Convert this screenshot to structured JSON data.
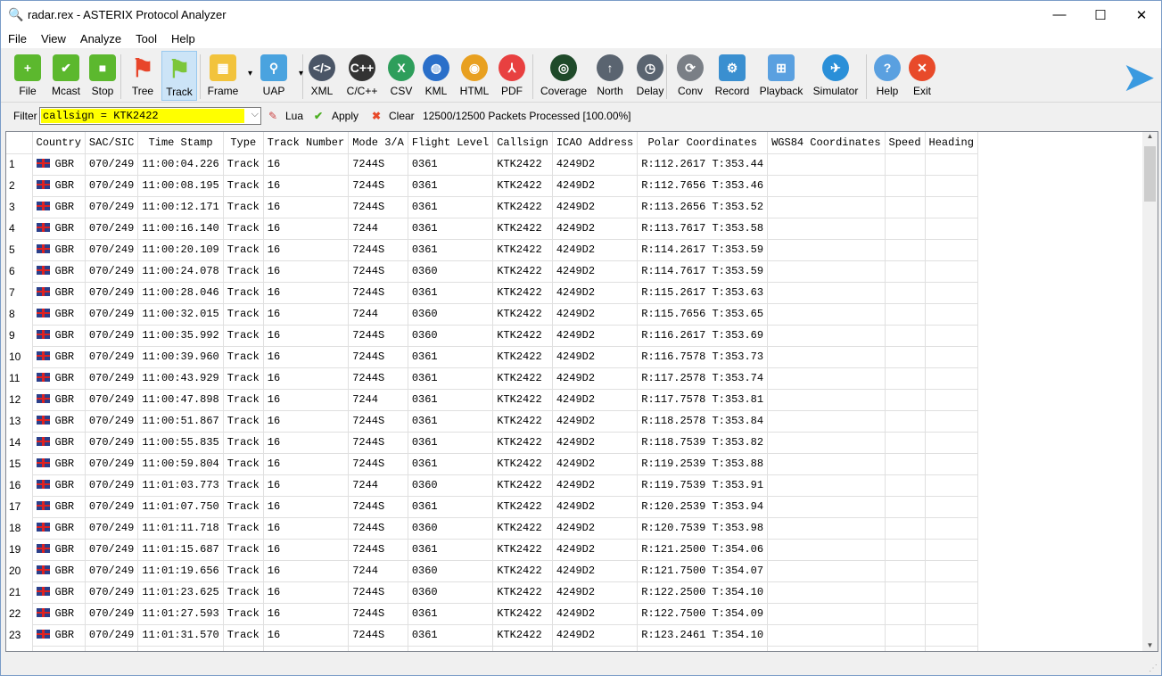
{
  "window": {
    "title": "radar.rex - ASTERIX Protocol Analyzer",
    "minimize": "—",
    "maximize": "☐",
    "close": "✕"
  },
  "menu": [
    "File",
    "View",
    "Analyze",
    "Tool",
    "Help"
  ],
  "toolbar": [
    {
      "label": "File",
      "icon": "plus-icon",
      "color": "#5cb82e",
      "glyph": "+"
    },
    {
      "label": "Mcast",
      "icon": "check-icon",
      "color": "#5cb82e",
      "glyph": "✔"
    },
    {
      "label": "Stop",
      "icon": "stop-icon",
      "color": "#5cb82e",
      "glyph": "■"
    },
    {
      "label": "Tree",
      "icon": "red-flag-icon",
      "color": "#e8452a",
      "glyph": "⚑"
    },
    {
      "label": "Track",
      "icon": "green-flag-icon",
      "color": "#7cc63a",
      "glyph": "⚑"
    },
    {
      "label": "Frame",
      "icon": "calendar-icon",
      "color": "#f2c33c",
      "glyph": "▦"
    },
    {
      "label": "UAP",
      "icon": "key-icon",
      "color": "#4aa3df",
      "glyph": "⚲"
    },
    {
      "label": "XML",
      "icon": "code-icon",
      "color": "#4a5566",
      "glyph": "</>"
    },
    {
      "label": "C/C++",
      "icon": "cpp-icon",
      "color": "#333333",
      "glyph": "C++"
    },
    {
      "label": "CSV",
      "icon": "excel-icon",
      "color": "#2e9e5b",
      "glyph": "X"
    },
    {
      "label": "KML",
      "icon": "globe-icon",
      "color": "#2a6fc9",
      "glyph": "◍"
    },
    {
      "label": "HTML",
      "icon": "chrome-icon",
      "color": "#e8a020",
      "glyph": "◉"
    },
    {
      "label": "PDF",
      "icon": "pdf-icon",
      "color": "#e84040",
      "glyph": "⅄"
    },
    {
      "label": "Coverage",
      "icon": "radar-icon",
      "color": "#1f4a2a",
      "glyph": "◎"
    },
    {
      "label": "North",
      "icon": "arrow-up-icon",
      "color": "#5a6470",
      "glyph": "↑"
    },
    {
      "label": "Delay",
      "icon": "clock-icon",
      "color": "#5a6470",
      "glyph": "◷"
    },
    {
      "label": "Conv",
      "icon": "convert-icon",
      "color": "#7a7f86",
      "glyph": "⟳"
    },
    {
      "label": "Record",
      "icon": "gear-icon",
      "color": "#3a8fd0",
      "glyph": "⚙"
    },
    {
      "label": "Playback",
      "icon": "network-icon",
      "color": "#5aa0e0",
      "glyph": "⊞"
    },
    {
      "label": "Simulator",
      "icon": "plane-icon",
      "color": "#2a8fd8",
      "glyph": "✈"
    },
    {
      "label": "Help",
      "icon": "help-icon",
      "color": "#5aa0e0",
      "glyph": "?"
    },
    {
      "label": "Exit",
      "icon": "close-icon",
      "color": "#e84a2a",
      "glyph": "✕"
    }
  ],
  "filter": {
    "label": "Filter",
    "value": "callsign = KTK2422",
    "lua": "Lua",
    "apply": "Apply",
    "clear": "Clear",
    "status": "12500/12500 Packets Processed [100.00%]"
  },
  "table": {
    "columns": [
      "",
      "Country",
      "SAC/SIC",
      "Time Stamp",
      "Type",
      "Track Number",
      "Mode 3/A",
      "Flight Level",
      "Callsign",
      "ICAO Address",
      "Polar Coordinates",
      "WGS84 Coordinates",
      "Speed",
      "Heading"
    ],
    "rows": [
      [
        "1",
        "GBR",
        "070/249",
        "11:00:04.226",
        "Track",
        "16",
        "7244S",
        "0361",
        "KTK2422",
        "4249D2",
        "R:112.2617 T:353.44",
        "",
        "",
        ""
      ],
      [
        "2",
        "GBR",
        "070/249",
        "11:00:08.195",
        "Track",
        "16",
        "7244S",
        "0361",
        "KTK2422",
        "4249D2",
        "R:112.7656 T:353.46",
        "",
        "",
        ""
      ],
      [
        "3",
        "GBR",
        "070/249",
        "11:00:12.171",
        "Track",
        "16",
        "7244S",
        "0361",
        "KTK2422",
        "4249D2",
        "R:113.2656 T:353.52",
        "",
        "",
        ""
      ],
      [
        "4",
        "GBR",
        "070/249",
        "11:00:16.140",
        "Track",
        "16",
        "7244",
        "0361",
        "KTK2422",
        "4249D2",
        "R:113.7617 T:353.58",
        "",
        "",
        ""
      ],
      [
        "5",
        "GBR",
        "070/249",
        "11:00:20.109",
        "Track",
        "16",
        "7244S",
        "0361",
        "KTK2422",
        "4249D2",
        "R:114.2617 T:353.59",
        "",
        "",
        ""
      ],
      [
        "6",
        "GBR",
        "070/249",
        "11:00:24.078",
        "Track",
        "16",
        "7244S",
        "0360",
        "KTK2422",
        "4249D2",
        "R:114.7617 T:353.59",
        "",
        "",
        ""
      ],
      [
        "7",
        "GBR",
        "070/249",
        "11:00:28.046",
        "Track",
        "16",
        "7244S",
        "0361",
        "KTK2422",
        "4249D2",
        "R:115.2617 T:353.63",
        "",
        "",
        ""
      ],
      [
        "8",
        "GBR",
        "070/249",
        "11:00:32.015",
        "Track",
        "16",
        "7244",
        "0360",
        "KTK2422",
        "4249D2",
        "R:115.7656 T:353.65",
        "",
        "",
        ""
      ],
      [
        "9",
        "GBR",
        "070/249",
        "11:00:35.992",
        "Track",
        "16",
        "7244S",
        "0360",
        "KTK2422",
        "4249D2",
        "R:116.2617 T:353.69",
        "",
        "",
        ""
      ],
      [
        "10",
        "GBR",
        "070/249",
        "11:00:39.960",
        "Track",
        "16",
        "7244S",
        "0361",
        "KTK2422",
        "4249D2",
        "R:116.7578 T:353.73",
        "",
        "",
        ""
      ],
      [
        "11",
        "GBR",
        "070/249",
        "11:00:43.929",
        "Track",
        "16",
        "7244S",
        "0361",
        "KTK2422",
        "4249D2",
        "R:117.2578 T:353.74",
        "",
        "",
        ""
      ],
      [
        "12",
        "GBR",
        "070/249",
        "11:00:47.898",
        "Track",
        "16",
        "7244",
        "0361",
        "KTK2422",
        "4249D2",
        "R:117.7578 T:353.81",
        "",
        "",
        ""
      ],
      [
        "13",
        "GBR",
        "070/249",
        "11:00:51.867",
        "Track",
        "16",
        "7244S",
        "0361",
        "KTK2422",
        "4249D2",
        "R:118.2578 T:353.84",
        "",
        "",
        ""
      ],
      [
        "14",
        "GBR",
        "070/249",
        "11:00:55.835",
        "Track",
        "16",
        "7244S",
        "0361",
        "KTK2422",
        "4249D2",
        "R:118.7539 T:353.82",
        "",
        "",
        ""
      ],
      [
        "15",
        "GBR",
        "070/249",
        "11:00:59.804",
        "Track",
        "16",
        "7244S",
        "0361",
        "KTK2422",
        "4249D2",
        "R:119.2539 T:353.88",
        "",
        "",
        ""
      ],
      [
        "16",
        "GBR",
        "070/249",
        "11:01:03.773",
        "Track",
        "16",
        "7244",
        "0360",
        "KTK2422",
        "4249D2",
        "R:119.7539 T:353.91",
        "",
        "",
        ""
      ],
      [
        "17",
        "GBR",
        "070/249",
        "11:01:07.750",
        "Track",
        "16",
        "7244S",
        "0361",
        "KTK2422",
        "4249D2",
        "R:120.2539 T:353.94",
        "",
        "",
        ""
      ],
      [
        "18",
        "GBR",
        "070/249",
        "11:01:11.718",
        "Track",
        "16",
        "7244S",
        "0360",
        "KTK2422",
        "4249D2",
        "R:120.7539 T:353.98",
        "",
        "",
        ""
      ],
      [
        "19",
        "GBR",
        "070/249",
        "11:01:15.687",
        "Track",
        "16",
        "7244S",
        "0361",
        "KTK2422",
        "4249D2",
        "R:121.2500 T:354.06",
        "",
        "",
        ""
      ],
      [
        "20",
        "GBR",
        "070/249",
        "11:01:19.656",
        "Track",
        "16",
        "7244",
        "0360",
        "KTK2422",
        "4249D2",
        "R:121.7500 T:354.07",
        "",
        "",
        ""
      ],
      [
        "21",
        "GBR",
        "070/249",
        "11:01:23.625",
        "Track",
        "16",
        "7244S",
        "0360",
        "KTK2422",
        "4249D2",
        "R:122.2500 T:354.10",
        "",
        "",
        ""
      ],
      [
        "22",
        "GBR",
        "070/249",
        "11:01:27.593",
        "Track",
        "16",
        "7244S",
        "0361",
        "KTK2422",
        "4249D2",
        "R:122.7500 T:354.09",
        "",
        "",
        ""
      ],
      [
        "23",
        "GBR",
        "070/249",
        "11:01:31.570",
        "Track",
        "16",
        "7244S",
        "0361",
        "KTK2422",
        "4249D2",
        "R:123.2461 T:354.10",
        "",
        "",
        ""
      ]
    ]
  }
}
